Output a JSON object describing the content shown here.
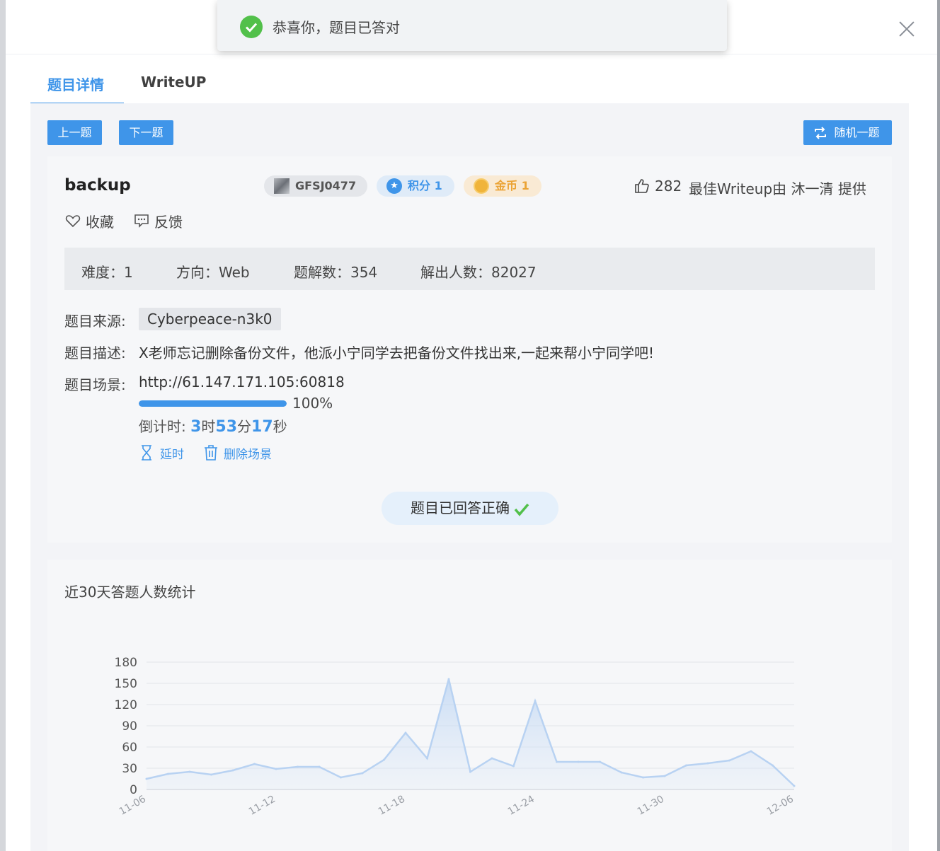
{
  "toast": {
    "message": "恭喜你，题目已答对"
  },
  "tabs": [
    {
      "label": "题目详情",
      "active": true
    },
    {
      "label": "WriteUP",
      "active": false
    }
  ],
  "nav": {
    "prev": "上一题",
    "next": "下一题",
    "random": "随机一题"
  },
  "challenge": {
    "title": "backup",
    "author": "GFSJ0477",
    "points": "积分 1",
    "gold": "金币 1",
    "likes": "282",
    "best_writeup": "最佳Writeup由 沐一清 提供",
    "favorite": "收藏",
    "feedback": "反馈",
    "stats": {
      "difficulty": "难度：1",
      "direction": "方向：Web",
      "solutions": "题解数：354",
      "solvers": "解出人数：82027"
    },
    "source_label": "题目来源:",
    "source": "Cyberpeace-n3k0",
    "desc_label": "题目描述:",
    "description": "X老师忘记删除备份文件，他派小宁同学去把备份文件找出来,一起来帮小宁同学吧!",
    "scene_label": "题目场景:",
    "scene_url": "http://61.147.171.105:60818",
    "progress": 100,
    "progress_text": "100%",
    "countdown": {
      "prefix": "倒计时: ",
      "hours": "3",
      "h": "时",
      "minutes": "53",
      "m": "分",
      "seconds": "17",
      "s": "秒"
    },
    "extend": "延时",
    "delete_scene": "删除场景",
    "answered": "题目已回答正确"
  },
  "colors": {
    "accent": "#3f95e9",
    "success": "#52c04a",
    "gold": "#eba334"
  },
  "chart_data": {
    "type": "area",
    "title": "近30天答题人数统计",
    "x": [
      "11-06",
      "11-07",
      "11-08",
      "11-09",
      "11-10",
      "11-11",
      "11-12",
      "11-13",
      "11-14",
      "11-15",
      "11-16",
      "11-17",
      "11-18",
      "11-19",
      "11-20",
      "11-21",
      "11-22",
      "11-23",
      "11-24",
      "11-25",
      "11-26",
      "11-27",
      "11-28",
      "11-29",
      "11-30",
      "12-01",
      "12-02",
      "12-03",
      "12-04",
      "12-05",
      "12-06"
    ],
    "x_tick_labels": [
      "11-06",
      "11-12",
      "11-18",
      "11-24",
      "11-30",
      "12-06"
    ],
    "series": [
      {
        "values": [
          15,
          22,
          25,
          21,
          27,
          36,
          29,
          32,
          32,
          17,
          23,
          42,
          80,
          44,
          156,
          25,
          44,
          33,
          125,
          39,
          39,
          39,
          24,
          17,
          19,
          34,
          37,
          41,
          54,
          34,
          5
        ]
      }
    ],
    "y_ticks": [
      0,
      30,
      60,
      90,
      120,
      150,
      180
    ],
    "ylim": [
      0,
      180
    ],
    "grid": true
  }
}
